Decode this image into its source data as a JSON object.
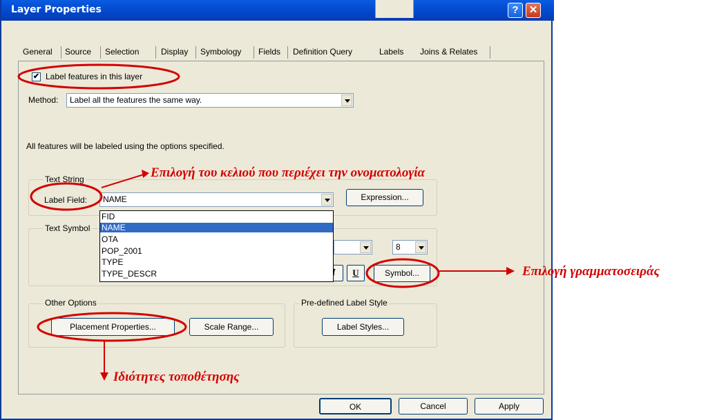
{
  "window": {
    "title": "Layer Properties",
    "help_symbol": "?",
    "close_symbol": "✕"
  },
  "tabs": [
    {
      "label": "General"
    },
    {
      "label": "Source"
    },
    {
      "label": "Selection"
    },
    {
      "label": "Display"
    },
    {
      "label": "Symbology"
    },
    {
      "label": "Fields"
    },
    {
      "label": "Definition Query"
    },
    {
      "label": "Labels"
    },
    {
      "label": "Joins & Relates"
    }
  ],
  "active_tab": "Labels",
  "labels_tab": {
    "label_features_checkbox": {
      "label": "Label features in this layer",
      "checked": true,
      "mark": "✔"
    },
    "method": {
      "label": "Method:",
      "value": "Label all the features the same way."
    },
    "info_text": "All features will be labeled using the options specified.",
    "text_string_group": {
      "title": "Text String",
      "label_field_label": "Label Field:",
      "label_field_value": "NAME",
      "expression_button": "Expression..."
    },
    "field_dropdown": {
      "options": [
        "FID",
        "NAME",
        "OTA",
        "POP_2001",
        "TYPE",
        "TYPE_DESCR"
      ],
      "selected": "NAME"
    },
    "text_symbol_group": {
      "title": "Text Symbol",
      "size_value": "8",
      "bold_label": "B",
      "italic_label": "I",
      "underline_label": "U",
      "symbol_button": "Symbol..."
    },
    "other_options_group": {
      "title": "Other Options",
      "placement_button": "Placement Properties...",
      "scale_button": "Scale Range..."
    },
    "predefined_group": {
      "title": "Pre-defined Label Style",
      "label_styles_button": "Label Styles..."
    }
  },
  "footer": {
    "ok": "OK",
    "cancel": "Cancel",
    "apply": "Apply"
  },
  "annotations": {
    "field_selection": "Επιλογή του κελιού που περιέχει την ονοματολογία",
    "font_selection": "Επιλογή γραμματοσειράς",
    "placement_properties": "Ιδιότητες τοποθέτησης",
    "color": "#d30000"
  }
}
